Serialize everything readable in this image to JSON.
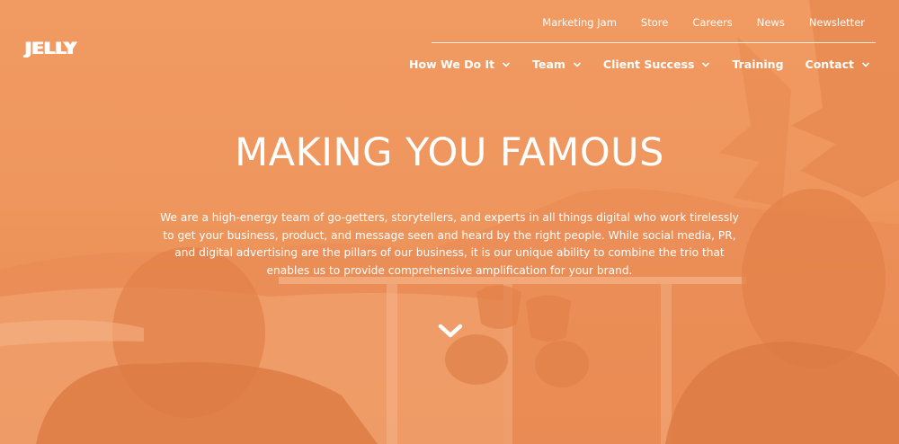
{
  "brand": {
    "logo_text": "JELLY"
  },
  "top_nav": {
    "items": [
      {
        "label": "Marketing Jam"
      },
      {
        "label": "Store"
      },
      {
        "label": "Careers"
      },
      {
        "label": "News"
      },
      {
        "label": "Newsletter"
      }
    ]
  },
  "main_nav": {
    "items": [
      {
        "label": "How We Do It",
        "has_dropdown": true
      },
      {
        "label": "Team",
        "has_dropdown": true
      },
      {
        "label": "Client Success",
        "has_dropdown": true
      },
      {
        "label": "Training",
        "has_dropdown": false
      },
      {
        "label": "Contact",
        "has_dropdown": true
      }
    ]
  },
  "hero": {
    "title": "MAKING YOU FAMOUS",
    "description": "We are a high-energy team of go-getters, storytellers, and experts in all things digital who work tirelessly to get your business, product, and message seen and heard by the right people. While social media, PR, and digital advertising are the pillars of our business, it is our unique ability to combine the trio that enables us to provide comprehensive amplification for your brand.",
    "scroll_icon": "chevron-down-icon"
  },
  "colors": {
    "overlay": "#f19a62",
    "text": "#ffffff"
  }
}
